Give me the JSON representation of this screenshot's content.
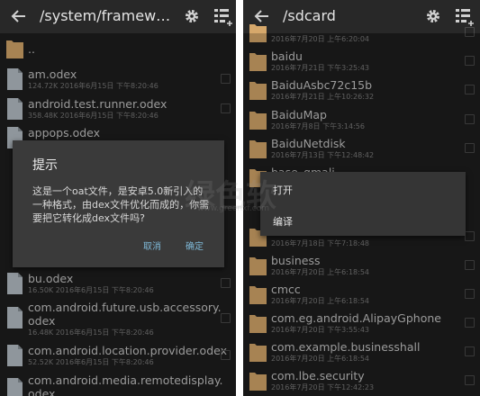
{
  "colors": {
    "background": "#1e1e1e",
    "toolbar": "#282828",
    "dialog": "#3a3a3a",
    "folder": "#d6a86b",
    "file": "#b8c0c8",
    "accent": "#7fb9d8"
  },
  "left": {
    "title": "/system/framework...",
    "rows": [
      {
        "name": "..",
        "meta": "",
        "icon": "folder-icon"
      },
      {
        "name": "am.odex",
        "meta": "124.72K 2016年6月15日 下午8:20:46",
        "icon": "file-icon"
      },
      {
        "name": "android.test.runner.odex",
        "meta": "358.48K 2016年6月15日 下午8:20:46",
        "icon": "file-icon"
      },
      {
        "name": "appops.odex",
        "meta": "",
        "icon": "file-icon"
      },
      {
        "name": "bu.odex",
        "meta": "16.50K 2016年6月15日 下午8:20:46",
        "icon": "file-icon"
      },
      {
        "name": "com.android.future.usb.accessory.",
        "name2": "odex",
        "meta": "16.48K 2016年6月15日 下午8:20:46",
        "icon": "file-icon"
      },
      {
        "name": "com.android.location.provider.odex",
        "meta": "52.52K 2016年6月15日 下午8:20:46",
        "icon": "file-icon"
      },
      {
        "name": "com.android.media.remotedisplay.",
        "name2": "odex",
        "meta": "",
        "icon": "file-icon"
      }
    ],
    "dialog": {
      "title": "提示",
      "message": "这是一个oat文件，是安卓5.0新引入的一种格式，由dex文件优化而成的，你需要把它转化成dex文件吗?",
      "cancel": "取消",
      "ok": "确定"
    }
  },
  "right": {
    "title": "/sdcard",
    "rows": [
      {
        "name": "",
        "meta": "2016年7月20日 上午6:20:04"
      },
      {
        "name": "baidu",
        "meta": "2016年7月21日 下午3:25:43"
      },
      {
        "name": "BaiduAsbc72c15b",
        "meta": "2016年7月21日 上午10:26:32"
      },
      {
        "name": "BaiduMap",
        "meta": "2016年7月8日 下午3:14:56"
      },
      {
        "name": "BaiduNetdisk",
        "meta": "2016年7月13日 下午12:48:42"
      },
      {
        "name": "base_gmali",
        "meta": ""
      },
      {
        "name": "",
        "meta": ""
      },
      {
        "name": "",
        "meta": "2016年7月18日 下午7:18:48"
      },
      {
        "name": "business",
        "meta": "2016年7月20日 上午6:18:54"
      },
      {
        "name": "cmcc",
        "meta": "2016年7月20日 上午6:18:54"
      },
      {
        "name": "com.eg.android.AlipayGphone",
        "meta": "2016年7月20日 下午3:55:43"
      },
      {
        "name": "com.example.businesshall",
        "meta": "2016年7月20日 上午6:18:54"
      },
      {
        "name": "com.lbe.security",
        "meta": "2016年7月20日 下午12:42:23"
      }
    ],
    "menu": {
      "open": "打开",
      "edit": "编译"
    }
  },
  "watermark": {
    "line1": "绿色软",
    "line2": "www.greenxf.com"
  }
}
